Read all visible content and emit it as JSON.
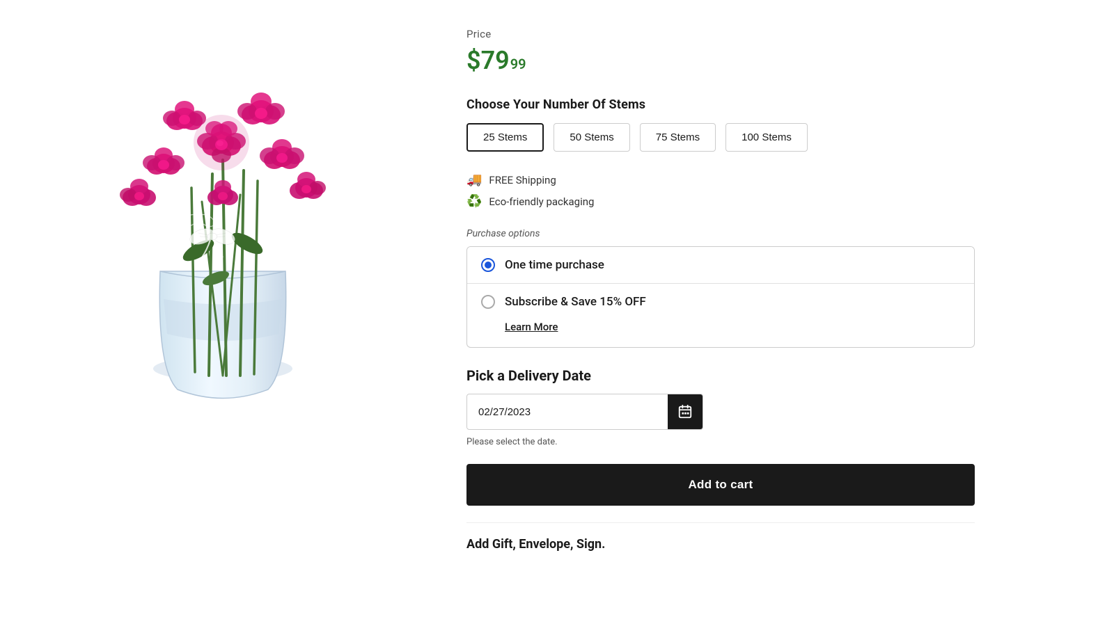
{
  "product": {
    "price_label": "Price",
    "price_main": "$79",
    "price_cents": "99",
    "price_color": "#2a7a2a"
  },
  "stems": {
    "section_title": "Choose Your Number Of Stems",
    "options": [
      {
        "label": "25 Stems",
        "selected": true
      },
      {
        "label": "50 Stems",
        "selected": false
      },
      {
        "label": "75 Stems",
        "selected": false
      },
      {
        "label": "100 Stems",
        "selected": false
      }
    ]
  },
  "features": [
    {
      "icon": "🚚",
      "text": "FREE Shipping"
    },
    {
      "icon": "♻️",
      "text": "Eco-friendly packaging"
    }
  ],
  "purchase_options": {
    "section_label": "Purchase options",
    "options": [
      {
        "label": "One time purchase",
        "selected": true
      },
      {
        "label": "Subscribe & Save 15% OFF",
        "selected": false
      }
    ],
    "learn_more_label": "Learn More"
  },
  "delivery": {
    "section_title": "Pick a Delivery Date",
    "date_value": "02/27/2023",
    "date_hint": "Please select the date."
  },
  "cart": {
    "add_to_cart_label": "Add to cart"
  },
  "bottom_section": {
    "title": "Add Gift, Envelope, Sign."
  }
}
